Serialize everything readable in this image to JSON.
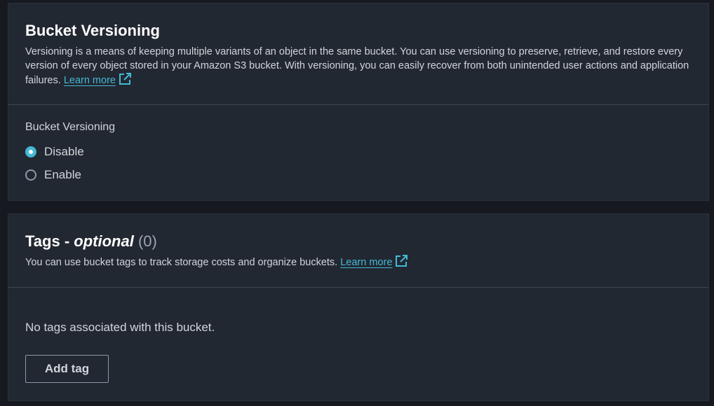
{
  "versioning_panel": {
    "title": "Bucket Versioning",
    "description": "Versioning is a means of keeping multiple variants of an object in the same bucket. You can use versioning to preserve, retrieve, and restore every version of every object stored in your Amazon S3 bucket. With versioning, you can easily recover from both unintended user actions and application failures.",
    "learn_more": "Learn more",
    "field_label": "Bucket Versioning",
    "options": [
      {
        "label": "Disable",
        "selected": true
      },
      {
        "label": "Enable",
        "selected": false
      }
    ]
  },
  "tags_panel": {
    "title": "Tags -",
    "title_optional": "optional",
    "count": "(0)",
    "description": "You can use bucket tags to track storage costs and organize buckets.",
    "learn_more": "Learn more",
    "empty_text": "No tags associated with this bucket.",
    "add_button": "Add tag"
  },
  "icons": {
    "external_link": "external-link-icon"
  },
  "colors": {
    "accent": "#44b9d6",
    "panel_bg": "#222831",
    "page_bg": "#16191f",
    "title": "#ffffff",
    "text": "#d1d5db",
    "muted": "#9ba7b6"
  }
}
